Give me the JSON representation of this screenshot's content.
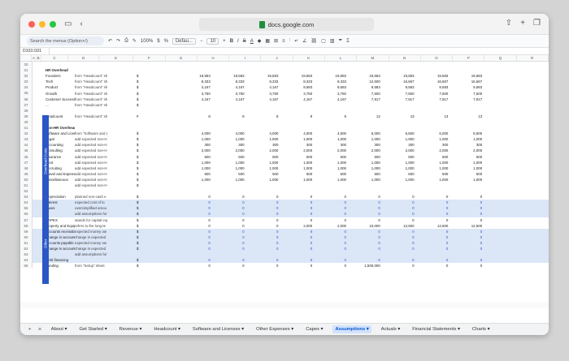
{
  "browser": {
    "url": "docs.google.com"
  },
  "toolbar": {
    "search_placeholder": "Search the menus (Option+/)",
    "zoom": "100%",
    "font": "Defau...",
    "font_size": "10"
  },
  "namebox": "D103:I101",
  "columns": [
    "A",
    "B",
    "C",
    "D",
    "E",
    "F",
    "G",
    "H",
    "I",
    "J",
    "K",
    "L",
    "M",
    "N",
    "O",
    "P",
    "Q",
    "R"
  ],
  "sections": {
    "overhead": "Overhead Costs",
    "other": "Other"
  },
  "rows": [
    {
      "n": "30",
      "label": "",
      "note": "",
      "unit": "",
      "vals": []
    },
    {
      "n": "31",
      "label": "HR Overhead",
      "note": "",
      "unit": "",
      "bold": true,
      "vals": []
    },
    {
      "n": "32",
      "label": "Founders",
      "note": "from \"Headcount\" sh",
      "unit": "$",
      "vals": [
        "19,583",
        "19,583",
        "19,583",
        "19,583",
        "19,583",
        "19,583",
        "19,583",
        "19,583",
        "19,583"
      ]
    },
    {
      "n": "33",
      "label": "Tech",
      "note": "from \"Headcount\" sh",
      "unit": "$",
      "vals": [
        "8,333",
        "8,333",
        "8,333",
        "8,333",
        "8,333",
        "12,500",
        "16,667",
        "16,667",
        "16,667"
      ]
    },
    {
      "n": "34",
      "label": "Product",
      "note": "from \"Headcount\" sh",
      "unit": "$",
      "vals": [
        "4,167",
        "4,167",
        "4,167",
        "9,583",
        "9,583",
        "9,583",
        "9,583",
        "9,583",
        "9,583"
      ]
    },
    {
      "n": "35",
      "label": "Growth",
      "note": "from \"Headcount\" sh",
      "unit": "$",
      "vals": [
        "3,750",
        "3,750",
        "3,750",
        "3,750",
        "3,750",
        "7,500",
        "7,500",
        "7,500",
        "7,500"
      ]
    },
    {
      "n": "36",
      "label": "Customer Success",
      "note": "from \"Headcount\" sh",
      "unit": "$",
      "vals": [
        "4,167",
        "4,167",
        "4,167",
        "4,167",
        "4,167",
        "7,917",
        "7,917",
        "7,917",
        "7,917"
      ]
    },
    {
      "n": "37",
      "label": "...",
      "note": "from \"Headcount\" sh",
      "unit": "$",
      "vals": []
    },
    {
      "n": "38",
      "label": "",
      "note": "",
      "unit": "",
      "vals": []
    },
    {
      "n": "39",
      "label": "Headcount",
      "note": "from \"Headcount\" sh",
      "unit": "#",
      "vals": [
        "8",
        "8",
        "8",
        "9",
        "9",
        "12",
        "13",
        "13",
        "13"
      ]
    },
    {
      "n": "40",
      "label": "",
      "note": "",
      "unit": "",
      "vals": []
    },
    {
      "n": "41",
      "label": "Non-HR Overhead",
      "note": "",
      "unit": "",
      "bold": true,
      "vals": []
    },
    {
      "n": "42",
      "label": "Software and Licens",
      "note": "from \"Software and L",
      "unit": "$",
      "vals": [
        "4,000",
        "4,000",
        "4,000",
        "4,000",
        "4,500",
        "6,000",
        "6,500",
        "6,000",
        "6,500"
      ]
    },
    {
      "n": "43",
      "label": "Legal",
      "note": "add expected non-H",
      "unit": "$",
      "vals": [
        "1,000",
        "1,000",
        "1,000",
        "1,000",
        "1,000",
        "1,000",
        "1,000",
        "1,000",
        "1,000"
      ]
    },
    {
      "n": "44",
      "label": "Accounting",
      "note": "add expected non-H",
      "unit": "$",
      "vals": [
        "300",
        "300",
        "300",
        "300",
        "300",
        "300",
        "300",
        "300",
        "300"
      ]
    },
    {
      "n": "45",
      "label": "Consulting",
      "note": "add expected non-H",
      "unit": "$",
      "vals": [
        "2,000",
        "2,000",
        "2,000",
        "2,000",
        "2,000",
        "2,000",
        "2,000",
        "2,000",
        "2,000"
      ]
    },
    {
      "n": "46",
      "label": "Insurance",
      "note": "add expected non-H",
      "unit": "$",
      "vals": [
        "500",
        "500",
        "500",
        "500",
        "500",
        "500",
        "500",
        "500",
        "500"
      ]
    },
    {
      "n": "47",
      "label": "Rent",
      "note": "add expected non-H",
      "unit": "$",
      "vals": [
        "1,000",
        "1,000",
        "1,000",
        "1,000",
        "1,000",
        "1,000",
        "1,000",
        "1,000",
        "1,000"
      ]
    },
    {
      "n": "48",
      "label": "Recruiting",
      "note": "add expected non-H",
      "unit": "$",
      "vals": [
        "1,000",
        "1,000",
        "1,000",
        "1,000",
        "1,000",
        "1,000",
        "1,000",
        "1,000",
        "1,000"
      ]
    },
    {
      "n": "49",
      "label": "Travel and Expense",
      "note": "add expected non-H",
      "unit": "$",
      "vals": [
        "500",
        "500",
        "500",
        "500",
        "500",
        "500",
        "500",
        "500",
        "500"
      ]
    },
    {
      "n": "50",
      "label": "Miscellaneous",
      "note": "add expected non-H",
      "unit": "$",
      "vals": [
        "1,000",
        "1,000",
        "1,000",
        "1,000",
        "1,000",
        "1,000",
        "1,000",
        "1,000",
        "1,000"
      ]
    },
    {
      "n": "51",
      "label": "...",
      "note": "add expected non-H",
      "unit": "$",
      "vals": []
    },
    {
      "n": "52",
      "label": "",
      "note": "",
      "unit": "",
      "vals": []
    },
    {
      "n": "53",
      "label": "Depreciation",
      "note": "planned non-cash e",
      "unit": "$",
      "vals": [
        "0",
        "0",
        "0",
        "0",
        "0",
        "0",
        "0",
        "0",
        "0"
      ]
    },
    {
      "n": "54",
      "label": "Interest",
      "note": "expected cost of lo",
      "unit": "$",
      "hl": true,
      "blue": true,
      "vals": [
        "0",
        "0",
        "0",
        "0",
        "0",
        "0",
        "0",
        "0",
        "0"
      ]
    },
    {
      "n": "55",
      "label": "Taxes",
      "note": "oversimplified amou",
      "unit": "$",
      "hl": true,
      "blue": true,
      "vals": [
        "0",
        "0",
        "0",
        "0",
        "0",
        "0",
        "0",
        "0",
        "0"
      ]
    },
    {
      "n": "56",
      "label": "...",
      "note": "add assumptions for",
      "unit": "$",
      "hl": true,
      "blue": true,
      "vals": [
        "0",
        "0",
        "0",
        "0",
        "0",
        "0",
        "0",
        "0",
        "0"
      ]
    },
    {
      "n": "57",
      "label": "CAPEX",
      "note": "stands for capital exp",
      "unit": "$",
      "vals": [
        "0",
        "0",
        "0",
        "0",
        "0",
        "0",
        "0",
        "0",
        "0"
      ]
    },
    {
      "n": "58",
      "label": "Property and Equipm",
      "note": "refers to the long-te",
      "unit": "$",
      "vals": [
        "0",
        "0",
        "0",
        "2,000",
        "2,000",
        "10,000",
        "12,500",
        "12,500",
        "12,500"
      ]
    },
    {
      "n": "59",
      "label": "Accounts receivable",
      "note": "expected money ow",
      "unit": "$",
      "hl": true,
      "blue": true,
      "vals": [
        "0",
        "0",
        "0",
        "0",
        "0",
        "0",
        "0",
        "0",
        "0"
      ]
    },
    {
      "n": "60",
      "label": "Change in accounts",
      "note": "change in expected",
      "unit": "$",
      "hl": true,
      "blue": true,
      "vals": [
        "0",
        "0",
        "0",
        "0",
        "0",
        "0",
        "0",
        "0",
        "0"
      ]
    },
    {
      "n": "61",
      "label": "Accounts payable",
      "note": "expected money ow",
      "unit": "$",
      "hl": true,
      "blue": true,
      "vals": [
        "0",
        "0",
        "0",
        "0",
        "0",
        "0",
        "0",
        "0",
        "0"
      ]
    },
    {
      "n": "62",
      "label": "Change in accounts",
      "note": "change in expected",
      "unit": "$",
      "hl": true,
      "blue": true,
      "vals": [
        "0",
        "0",
        "0",
        "0",
        "0",
        "0",
        "0",
        "0",
        "0"
      ]
    },
    {
      "n": "63",
      "label": "",
      "note": "add assumptions for",
      "unit": "",
      "hl": true,
      "vals": []
    },
    {
      "n": "64",
      "label": "Debt financing",
      "note": "",
      "unit": "$",
      "hl": true,
      "blue": true,
      "vals": [
        "0",
        "0",
        "0",
        "0",
        "0",
        "0",
        "0",
        "0",
        "0"
      ]
    },
    {
      "n": "65",
      "label": "Funding",
      "note": "from \"Setup\" sheet",
      "unit": "$",
      "vals": [
        "0",
        "0",
        "0",
        "0",
        "0",
        "1,500,000",
        "0",
        "0",
        "0"
      ]
    }
  ],
  "tabs": [
    "About",
    "Get Started",
    "Revenue",
    "Headcount",
    "Software and Licenses",
    "Other Expenses",
    "Capex",
    "Assumptions",
    "Actuals",
    "Financial Statements",
    "Charts"
  ],
  "active_tab": "Assumptions"
}
